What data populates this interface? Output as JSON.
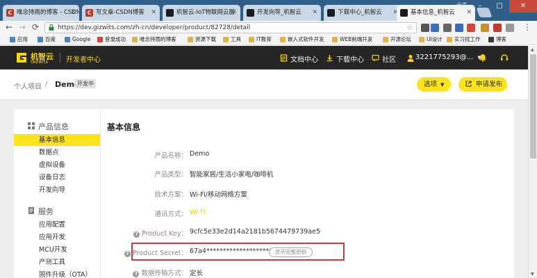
{
  "browser": {
    "tabs": [
      {
        "title": "唯念持雨的博客 - CSDN",
        "favicon": "csdn"
      },
      {
        "title": "写文章-CSDN博客",
        "favicon": "csdn"
      },
      {
        "title": "机智云-IoT物联网云服",
        "favicon": "gizwits"
      },
      {
        "title": "开发向导_机智云",
        "favicon": "gizwits"
      },
      {
        "title": "下载中心_机智云",
        "favicon": "gizwits"
      },
      {
        "title": "基本信息_机智云",
        "favicon": "gizwits",
        "active": true
      }
    ],
    "window_user": "云先",
    "url": "https://dev.gizwits.com/zh-cn/developer/product/82728/detail",
    "bookmarks": [
      "应用",
      "百度",
      "Google",
      "登录成功",
      "唯念持雨的博客",
      "资源下载",
      "工具",
      "IT教育",
      "嵌入式软件开发",
      "WEB前端开发",
      "开源论坛",
      "UI设计",
      "实习找工作",
      "博客"
    ]
  },
  "header": {
    "logo_text": "机智云",
    "logo_sub": "Gizwits",
    "section": "开发者中心",
    "nav": [
      "文档中心",
      "下载中心",
      "社区"
    ],
    "user": "3221775293@...",
    "accent": "#fde31a"
  },
  "breadcrumb": {
    "parent": "个人项目",
    "separator": "/",
    "current": "Demo",
    "badge": "开发中"
  },
  "actions": {
    "options_label": "选项",
    "publish_label": "申请发布"
  },
  "sidebar": {
    "sections": [
      {
        "title": "产品信息",
        "items": [
          "基本信息",
          "数据点",
          "虚拟设备",
          "设备日志",
          "开发向导"
        ]
      },
      {
        "title": "服务",
        "items": [
          "应用配置",
          "应用开发",
          "MCU开发",
          "产测工具",
          "固件升级（OTA）"
        ]
      }
    ],
    "active_item": "基本信息"
  },
  "content": {
    "title": "基本信息",
    "rows": [
      {
        "label": "产品名称：",
        "value": "Demo"
      },
      {
        "label": "产品类型：",
        "value": "智能家居/生活小家电/咖啡机"
      },
      {
        "label": "技术方案：",
        "value": "Wi-Fi/移动网络方案"
      },
      {
        "label": "通讯方式：",
        "value": "Wi-Fi"
      },
      {
        "label": "Product Key：",
        "value": "9cfc5e33e2d14a2181b5674479739ae5"
      },
      {
        "label": "Product Secret：",
        "value": "67a4********************a7fd"
      },
      {
        "label": "数据传输方式：",
        "value": "定长"
      }
    ],
    "reveal_label": "显示完整密钥"
  }
}
